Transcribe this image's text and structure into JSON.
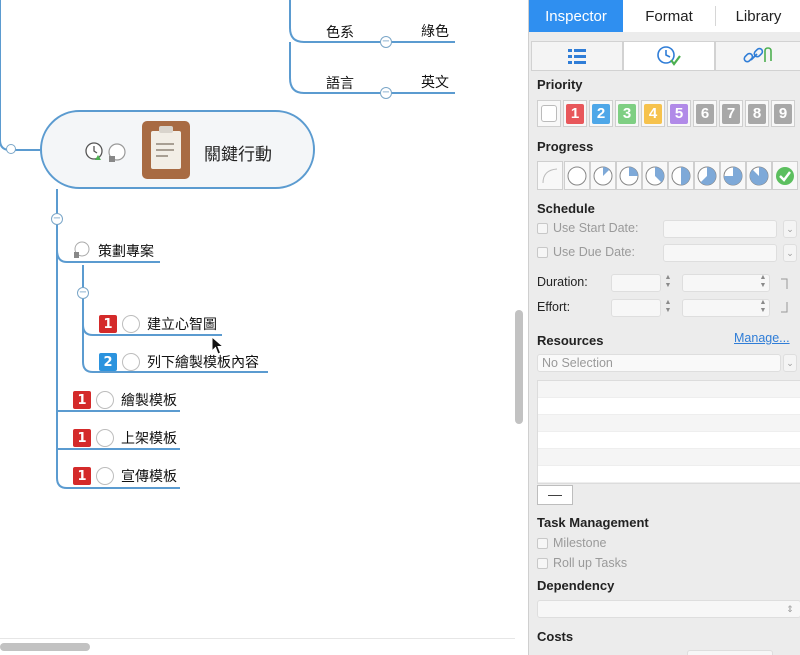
{
  "canvas": {
    "branch_labels": {
      "color_label": "色系",
      "color_value": "綠色",
      "language_label": "語言",
      "language_value": "英文"
    },
    "main_topic": {
      "label": "關鍵行動",
      "icons": [
        "clock-progress-icon",
        "half-circle-icon",
        "clipboard-document-icon"
      ]
    },
    "subtopics": [
      {
        "label": "策劃專案",
        "priority": null
      },
      {
        "label": "建立心智圖",
        "priority": "1"
      },
      {
        "label": "列下繪製模板內容",
        "priority": "2"
      },
      {
        "label": "繪製模板",
        "priority": "1"
      },
      {
        "label": "上架模板",
        "priority": "1"
      },
      {
        "label": "宣傳模板",
        "priority": "1"
      }
    ],
    "collapse_symbol": "−"
  },
  "inspector": {
    "tabs": [
      "Inspector",
      "Format",
      "Library"
    ],
    "subtab_icons": [
      "list-icon",
      "task-clock-icon",
      "link-attachment-icon"
    ],
    "priority": {
      "title": "Priority",
      "levels": [
        "1",
        "2",
        "3",
        "4",
        "5",
        "6",
        "7",
        "8",
        "9"
      ],
      "colors": [
        "#e8575b",
        "#4ea7e8",
        "#7fcf83",
        "#f6c24d",
        "#b18ae8",
        "#a8a8a8",
        "#a8a8a8",
        "#a8a8a8",
        "#a8a8a8"
      ]
    },
    "progress": {
      "title": "Progress",
      "levels": [
        "0%",
        "12.5%",
        "25%",
        "37.5%",
        "50%",
        "62.5%",
        "75%",
        "87.5%",
        "100%"
      ]
    },
    "schedule": {
      "title": "Schedule",
      "use_start_date": "Use Start Date:",
      "use_due_date": "Use Due Date:",
      "duration": "Duration:",
      "effort": "Effort:"
    },
    "resources": {
      "title": "Resources",
      "manage": "Manage...",
      "select_placeholder": "No Selection",
      "remove_button": "—"
    },
    "task_management": {
      "title": "Task Management",
      "milestone": "Milestone",
      "roll_up": "Roll up Tasks"
    },
    "dependency": {
      "title": "Dependency"
    },
    "costs": {
      "title": "Costs"
    },
    "accent_color": "#2f8ff0"
  }
}
